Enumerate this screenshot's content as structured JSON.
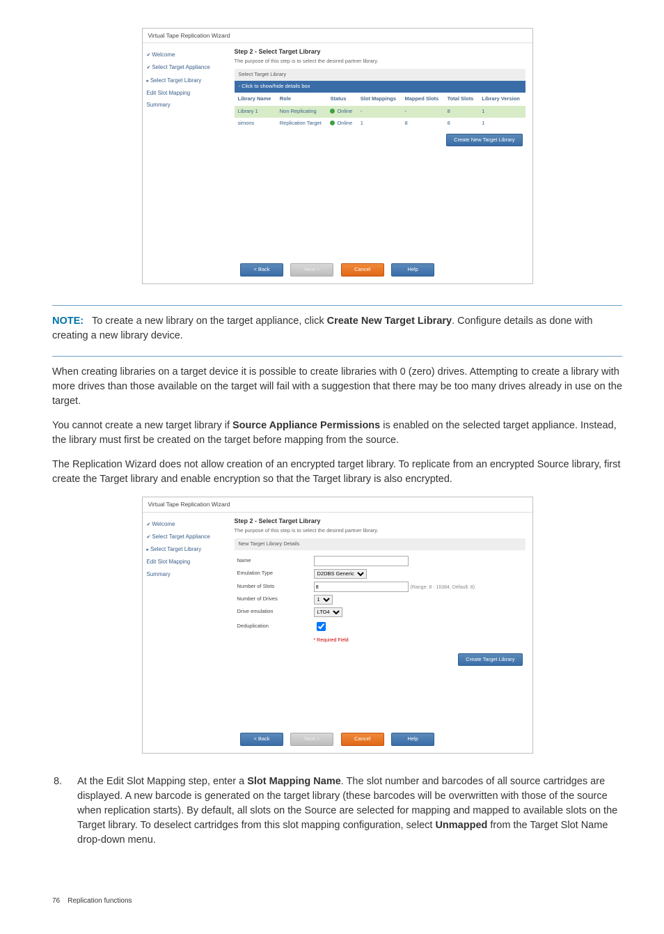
{
  "wizard1": {
    "title": "Virtual Tape Replication Wizard",
    "sidebar": [
      {
        "label": "Welcome",
        "state": "done"
      },
      {
        "label": "Select Target Appliance",
        "state": "done"
      },
      {
        "label": "Select Target Library",
        "state": "cur"
      },
      {
        "label": "Edit Slot Mapping",
        "state": ""
      },
      {
        "label": "Summary",
        "state": ""
      }
    ],
    "heading": "Step 2 - Select Target Library",
    "subtext": "The purpose of this step is to select the desired partner library.",
    "section_label": "Select Target Library",
    "bluebar": "- Click to show/hide details box",
    "columns": [
      "Library Name",
      "Role",
      "Status",
      "Slot Mappings",
      "Mapped Slots",
      "Total Slots",
      "Library Version"
    ],
    "rows": [
      {
        "name": "Library 1",
        "role": "Non Replicating",
        "status": "Online",
        "mappings": "-",
        "mapped": "-",
        "total": "8",
        "ver": "1",
        "sel": true
      },
      {
        "name": "simons",
        "role": "Replication Target",
        "status": "Online",
        "mappings": "1",
        "mapped": "8",
        "total": "8",
        "ver": "1",
        "sel": false
      }
    ],
    "create_btn": "Create New Target Library",
    "footer": {
      "back": "< Back",
      "next": "Next >",
      "cancel": "Cancel",
      "help": "Help"
    }
  },
  "note": {
    "label": "NOTE:",
    "text_a": "To create a new library on the target appliance, click ",
    "bold_a": "Create New Target Library",
    "text_b": ". Configure details as done with creating a new library device."
  },
  "para1": "When creating libraries on a target device it is possible to create libraries with 0 (zero) drives. Attempting to create a library with more drives than those available on the target will fail with a suggestion that there may be too many drives already in use on the target.",
  "para2": {
    "a": "You cannot create a new target library if ",
    "b": "Source Appliance Permissions",
    "c": " is enabled on the selected target appliance. Instead, the library must first be created on the target before mapping from the source."
  },
  "para3": "The Replication Wizard does not allow creation of an encrypted target library. To replicate from an encrypted Source library, first create the Target library and enable encryption so that the Target library is also encrypted.",
  "wizard2": {
    "title": "Virtual Tape Replication Wizard",
    "sidebar": [
      {
        "label": "Welcome",
        "state": "done"
      },
      {
        "label": "Select Target Appliance",
        "state": "done"
      },
      {
        "label": "Select Target Library",
        "state": "cur"
      },
      {
        "label": "Edit Slot Mapping",
        "state": ""
      },
      {
        "label": "Summary",
        "state": ""
      }
    ],
    "heading": "Step 2 - Select Target Library",
    "subtext": "The purpose of this step is to select the desired partner library.",
    "section_label": "New Target Library Details",
    "fields": {
      "name": {
        "label": "Name",
        "value": ""
      },
      "emulation": {
        "label": "Emulation Type",
        "value": "D2DBS Generic"
      },
      "slots": {
        "label": "Number of Slots",
        "value": "8",
        "hint": "(Range: 8 - 16384, Default: 8)"
      },
      "drives": {
        "label": "Number of Drives",
        "value": "1"
      },
      "drive_emu": {
        "label": "Drive emulation",
        "value": "LTO4"
      },
      "dedup": {
        "label": "Deduplication",
        "checked": true
      }
    },
    "required": "* Required Field",
    "create_btn": "Create Target Library",
    "footer": {
      "back": "< Back",
      "next": "Next >",
      "cancel": "Cancel",
      "help": "Help"
    }
  },
  "step8": {
    "num": "8.",
    "a": "At the Edit Slot Mapping step, enter a ",
    "b": "Slot Mapping Name",
    "c": ". The slot number and barcodes of all source cartridges are displayed. A new barcode is generated on the target library (these barcodes will be overwritten with those of the source when replication starts). By default, all slots on the Source are selected for mapping and mapped to available slots on the Target library. To deselect cartridges from this slot mapping configuration, select ",
    "d": "Unmapped",
    "e": " from the Target Slot Name drop-down menu."
  },
  "footer": {
    "page": "76",
    "title": "Replication functions"
  }
}
